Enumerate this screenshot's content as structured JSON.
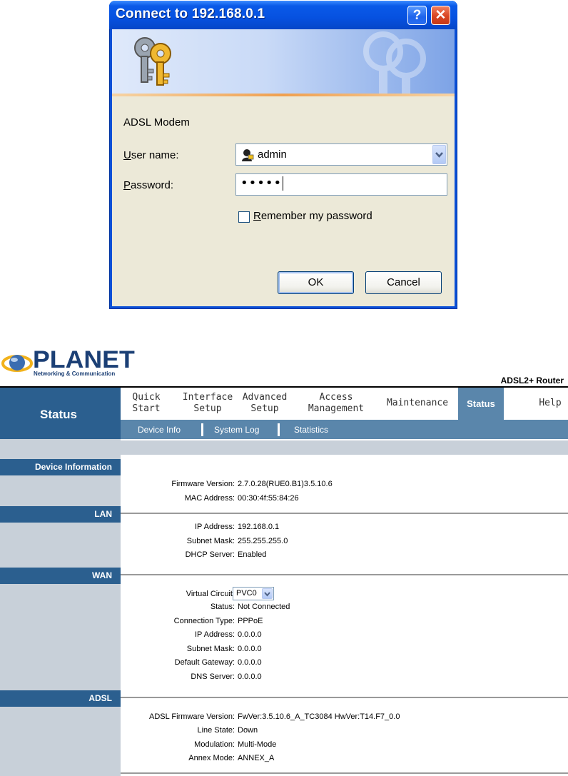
{
  "dialog": {
    "title": "Connect to 192.168.0.1",
    "realm": "ADSL Modem",
    "username_label_u": "U",
    "username_label_rest": "ser name:",
    "username_value": "admin",
    "password_label_u": "P",
    "password_label_rest": "assword:",
    "password_value": "•••••",
    "remember_u": "R",
    "remember_rest": "emember my password",
    "ok_label": "OK",
    "cancel_label": "Cancel",
    "help_glyph": "?",
    "close_glyph": "✕"
  },
  "router": {
    "brand": "PLANET",
    "tagline": "Networking & Communication",
    "product": "ADSL2+ Router",
    "current_section": "Status",
    "nav": [
      {
        "line1": "Quick",
        "line2": "Start"
      },
      {
        "line1": "Interface",
        "line2": "Setup"
      },
      {
        "line1": "Advanced",
        "line2": "Setup"
      },
      {
        "line1": "Access",
        "line2": "Management"
      },
      {
        "line1": "Maintenance",
        "line2": ""
      },
      {
        "line1": "Status",
        "line2": ""
      },
      {
        "line1": "Help",
        "line2": ""
      }
    ],
    "subnav": [
      "Device Info",
      "System Log",
      "Statistics"
    ],
    "sections": {
      "device": {
        "title": "Device Information",
        "rows": [
          {
            "label": "Firmware Version",
            "value": "2.7.0.28(RUE0.B1)3.5.10.6"
          },
          {
            "label": "MAC Address",
            "value": "00:30:4f:55:84:26"
          }
        ]
      },
      "lan": {
        "title": "LAN",
        "rows": [
          {
            "label": "IP Address",
            "value": "192.168.0.1"
          },
          {
            "label": "Subnet Mask",
            "value": "255.255.255.0"
          },
          {
            "label": "DHCP Server",
            "value": "Enabled"
          }
        ]
      },
      "wan": {
        "title": "WAN",
        "virtual_circuit_label": "Virtual Circuit",
        "virtual_circuit_value": "PVC0",
        "rows": [
          {
            "label": "Status",
            "value": "Not Connected"
          },
          {
            "label": "Connection Type",
            "value": "PPPoE"
          },
          {
            "label": "IP Address",
            "value": "0.0.0.0"
          },
          {
            "label": "Subnet Mask",
            "value": "0.0.0.0"
          },
          {
            "label": "Default Gateway",
            "value": "0.0.0.0"
          },
          {
            "label": "DNS Server",
            "value": "0.0.0.0"
          }
        ]
      },
      "adsl": {
        "title": "ADSL",
        "rows": [
          {
            "label": "ADSL Firmware Version",
            "value": "FwVer:3.5.10.6_A_TC3084 HwVer:T14.F7_0.0"
          },
          {
            "label": "Line State",
            "value": "Down"
          },
          {
            "label": "Modulation",
            "value": "Multi-Mode"
          },
          {
            "label": "Annex Mode",
            "value": "ANNEX_A"
          }
        ]
      }
    }
  }
}
